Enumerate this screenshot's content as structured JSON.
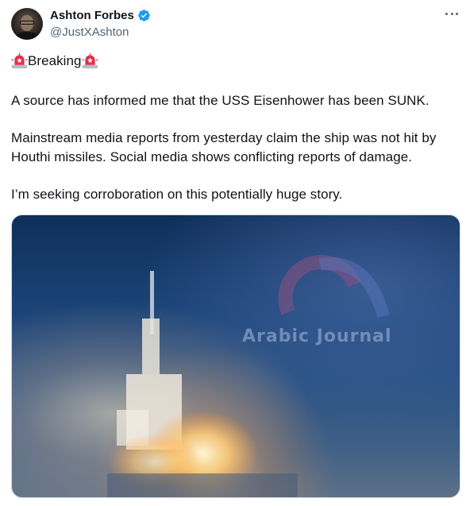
{
  "author": {
    "name": "Ashton Forbes",
    "handle": "@JustXAshton"
  },
  "tweet": {
    "breaking": "Breaking",
    "line1": "A source has informed me that the USS Eisenhower has been SUNK.",
    "line2": "Mainstream media reports from yesterday claim the ship was not hit by",
    "line3": "Houthi missiles. Social media shows conflicting reports of damage.",
    "line4": "I’m seeking corroboration on this potentially huge story."
  },
  "media": {
    "watermark": "Arabic Journal"
  },
  "colors": {
    "verified": "#1d9bf0",
    "siren": "#e0314b"
  }
}
